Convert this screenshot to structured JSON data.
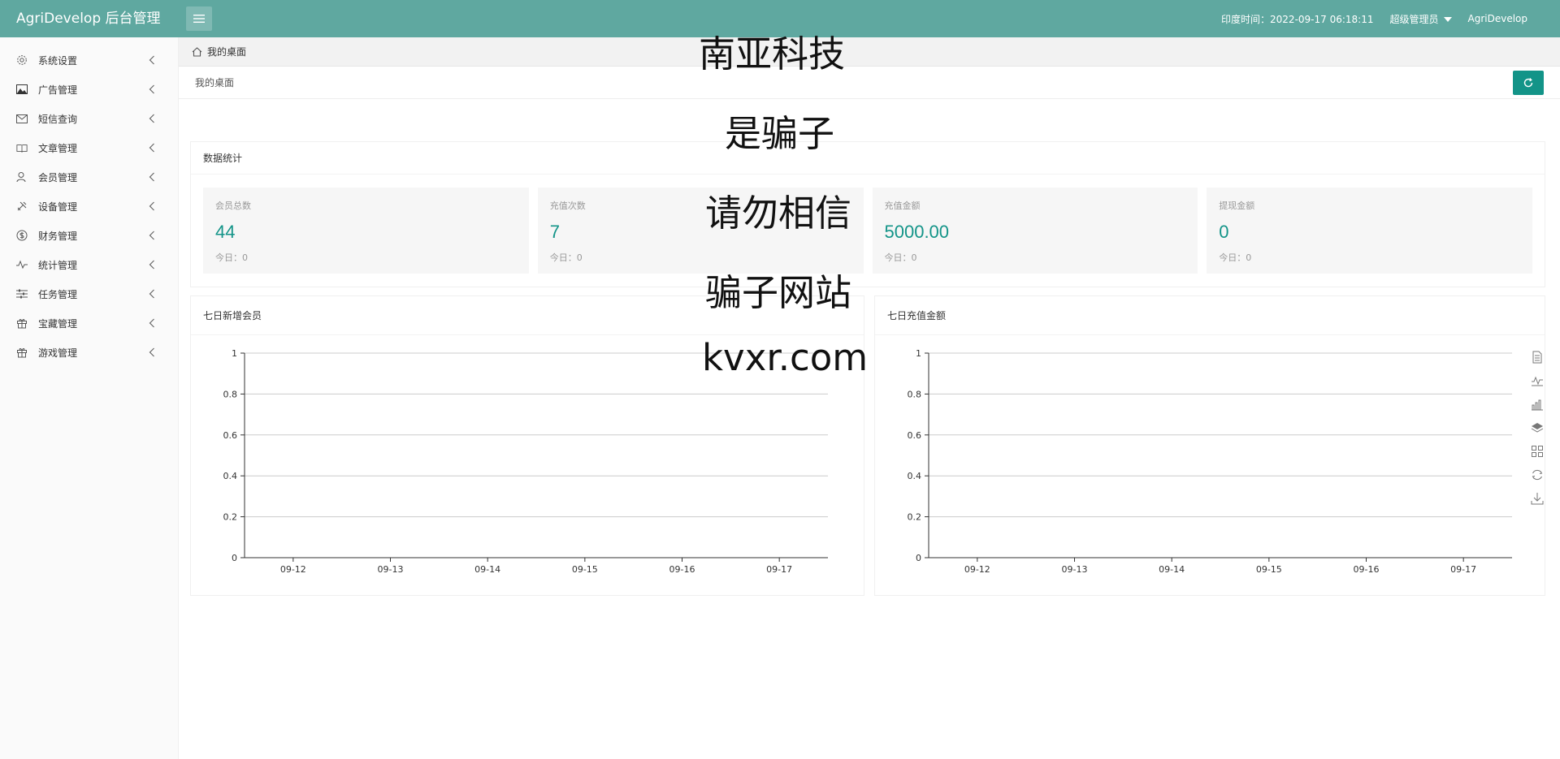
{
  "header": {
    "brand": "AgriDevelop 后台管理",
    "time_label": "印度时间：2022-09-17 06:18:11",
    "role": "超级管理员",
    "user": "AgriDevelop"
  },
  "sidebar": {
    "items": [
      {
        "label": "系统设置",
        "icon": "gear-icon"
      },
      {
        "label": "广告管理",
        "icon": "image-icon"
      },
      {
        "label": "短信查询",
        "icon": "mail-icon"
      },
      {
        "label": "文章管理",
        "icon": "book-icon"
      },
      {
        "label": "会员管理",
        "icon": "users-icon"
      },
      {
        "label": "设备管理",
        "icon": "tools-icon"
      },
      {
        "label": "财务管理",
        "icon": "dollar-icon"
      },
      {
        "label": "统计管理",
        "icon": "pulse-icon"
      },
      {
        "label": "任务管理",
        "icon": "sliders-icon"
      },
      {
        "label": "宝藏管理",
        "icon": "gift-icon"
      },
      {
        "label": "游戏管理",
        "icon": "gift-icon"
      }
    ]
  },
  "breadcrumb": {
    "home": "我的桌面"
  },
  "page": {
    "title": "我的桌面"
  },
  "stats": {
    "title": "数据统计",
    "cards": [
      {
        "label": "会员总数",
        "value": "44",
        "today": "今日：0"
      },
      {
        "label": "充值次数",
        "value": "7",
        "today": "今日：0"
      },
      {
        "label": "充值金额",
        "value": "5000.00",
        "today": "今日：0"
      },
      {
        "label": "提现金额",
        "value": "0",
        "today": "今日：0"
      }
    ]
  },
  "charts": {
    "left_title": "七日新增会员",
    "right_title": "七日充值金额"
  },
  "chart_data": [
    {
      "type": "line",
      "title": "七日新增会员",
      "categories": [
        "09-12",
        "09-13",
        "09-14",
        "09-15",
        "09-16",
        "09-17"
      ],
      "yticks": [
        "0",
        "0.2",
        "0.4",
        "0.6",
        "0.8",
        "1"
      ],
      "ylim": [
        0,
        1
      ],
      "grid": true
    },
    {
      "type": "line",
      "title": "七日充值金额",
      "categories": [
        "09-12",
        "09-13",
        "09-14",
        "09-15",
        "09-16",
        "09-17"
      ],
      "yticks": [
        "0",
        "0.2",
        "0.4",
        "0.6",
        "0.8",
        "1"
      ],
      "ylim": [
        0,
        1
      ],
      "grid": true
    }
  ],
  "overlay": {
    "lines": [
      "南亚科技",
      "是骗子",
      "请勿相信",
      "骗子网站",
      "kvxr.com"
    ]
  },
  "colors": {
    "header": "#5fa8a0",
    "accent": "#139488"
  }
}
